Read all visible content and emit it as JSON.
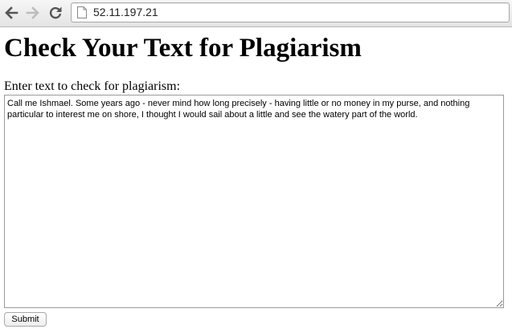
{
  "browser": {
    "url": "52.11.197.21",
    "icons": {
      "back": "arrow-left-icon",
      "forward": "arrow-right-icon",
      "reload": "reload-icon",
      "page": "page-icon"
    }
  },
  "page": {
    "title": "Check Your Text for Plagiarism",
    "field_label": "Enter text to check for plagiarism:",
    "textarea_value": "Call me Ishmael. Some years ago - never mind how long precisely - having little or no money in my purse, and nothing particular to interest me on shore, I thought I would sail about a little and see the watery part of the world.",
    "submit_label": "Submit"
  }
}
